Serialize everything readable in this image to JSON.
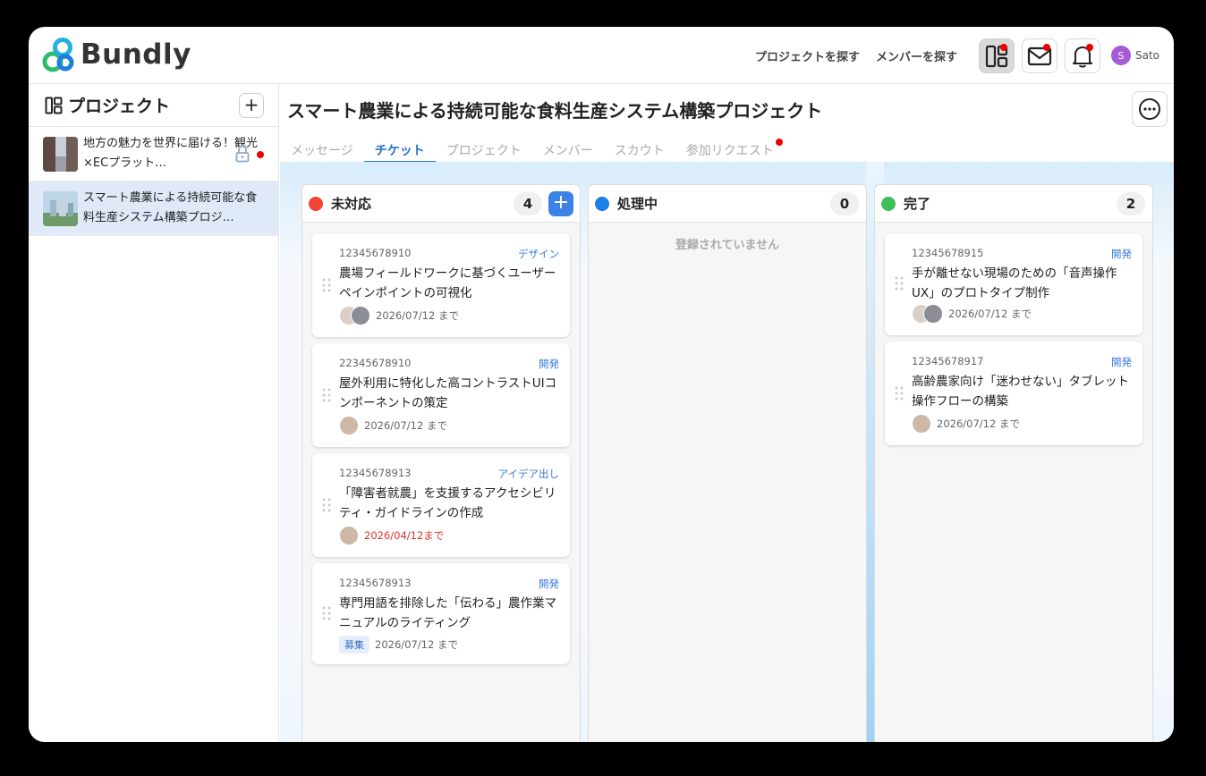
{
  "header": {
    "brand": "Bundly",
    "nav": [
      "プロジェクトを探す",
      "メンバーを探す"
    ],
    "user_initial": "S",
    "user_name": "Sato"
  },
  "sidebar": {
    "title": "プロジェクト",
    "items": [
      {
        "name": "地方の魅力を世界に届ける！観光×ECプラット…",
        "locked": true,
        "unread": true,
        "selected": false
      },
      {
        "name": "スマート農業による持続可能な食料生産システム構築プロジ…",
        "locked": false,
        "unread": false,
        "selected": true
      }
    ]
  },
  "main": {
    "title": "スマート農業による持続可能な食料生産システム構築プロジェクト",
    "tabs": [
      "メッセージ",
      "チケット",
      "プロジェクト",
      "メンバー",
      "スカウト",
      "参加リクエスト"
    ],
    "active_tab": "チケット"
  },
  "columns": [
    {
      "title": "未対応",
      "count": "4",
      "color": "#f04438",
      "cards": [
        {
          "id": "12345678910",
          "tag": "デザイン",
          "title": "農場フィールドワークに基づくユーザーペインポイントの可視化",
          "due": "2026/07/12 まで"
        },
        {
          "id": "22345678910",
          "tag": "開発",
          "title": "屋外利用に特化した高コントラストUIコンポーネントの策定",
          "due": "2026/07/12 まで"
        },
        {
          "id": "12345678913",
          "tag": "アイデア出し",
          "title": "「障害者就農」を支援するアクセシビリティ・ガイドラインの作成",
          "due": "2026/04/12まで"
        },
        {
          "id": "12345678913",
          "tag": "開発",
          "title": "専門用語を排除した「伝わる」農作業マニュアルのライティング",
          "badge": "募集",
          "due": "2026/07/12 まで"
        }
      ]
    },
    {
      "title": "処理中",
      "count": "0",
      "color": "#1a7fe8",
      "empty": "登録されていません"
    },
    {
      "title": "完了",
      "count": "2",
      "color": "#3fbf5a",
      "cards": [
        {
          "id": "12345678915",
          "tag": "開発",
          "title": "手が離せない現場のための「音声操作UX」のプロトタイプ制作",
          "due": "2026/07/12 まで"
        },
        {
          "id": "12345678917",
          "tag": "開発",
          "title": "高齢農家向け「迷わせない」タブレット操作フローの構築",
          "due": "2026/07/12 まで"
        }
      ]
    }
  ],
  "colors": {
    "accent": "#2a74c9",
    "add_button": "#3b82e6",
    "selected_row": "#dfe9f8",
    "overdue": "#d9342b"
  }
}
